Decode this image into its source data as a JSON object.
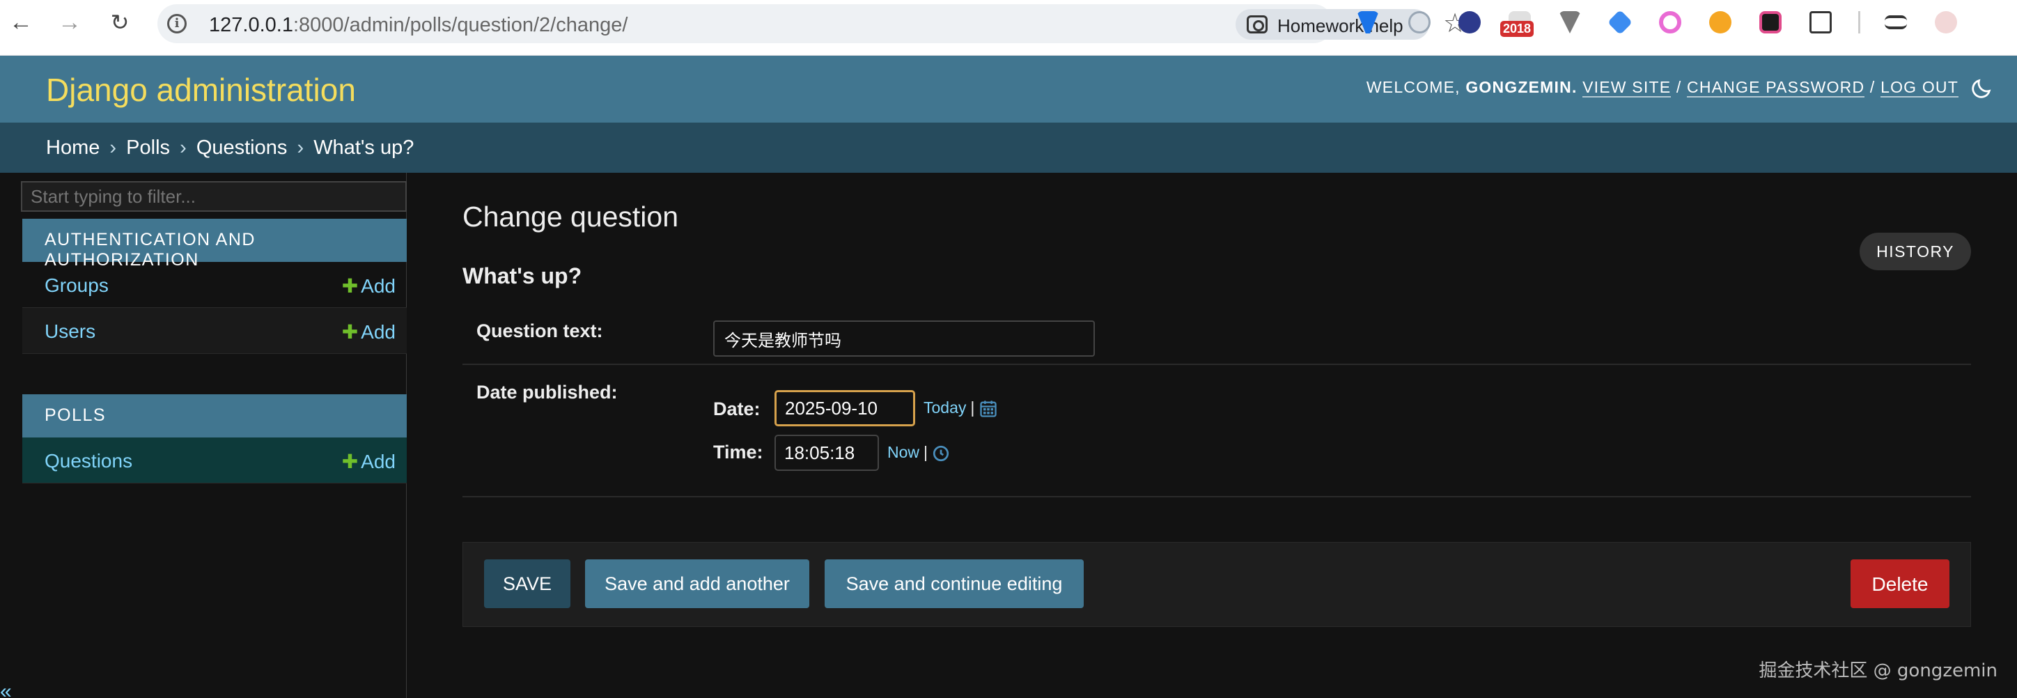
{
  "browser": {
    "url_host": "127.0.0.1",
    "url_path": ":8000/admin/polls/question/2/change/",
    "chip_label": "Homework help",
    "extension_badge": "2018"
  },
  "header": {
    "site_name": "Django administration",
    "welcome": "WELCOME,",
    "username": "GONGZEMIN.",
    "view_site": "VIEW SITE",
    "change_password": "CHANGE PASSWORD",
    "log_out": "LOG OUT",
    "separator": "/"
  },
  "breadcrumbs": {
    "items": [
      "Home",
      "Polls",
      "Questions",
      "What's up?"
    ],
    "separator": "›"
  },
  "sidebar": {
    "filter_placeholder": "Start typing to filter...",
    "apps": [
      {
        "caption": "AUTHENTICATION AND AUTHORIZATION",
        "models": [
          {
            "name": "Groups",
            "add_label": "Add"
          },
          {
            "name": "Users",
            "add_label": "Add"
          }
        ]
      },
      {
        "caption": "POLLS",
        "models": [
          {
            "name": "Questions",
            "add_label": "Add",
            "current": true
          }
        ]
      }
    ],
    "plus_symbol": "✚",
    "collapse_symbol": "«"
  },
  "content": {
    "page_title": "Change question",
    "history_label": "HISTORY",
    "object_title": "What's up?",
    "question_text": {
      "label": "Question text:",
      "value": "今天是教师节吗"
    },
    "date_published": {
      "label": "Date published:",
      "date_label": "Date:",
      "date_value": "2025-09-10",
      "today_label": "Today",
      "time_label": "Time:",
      "time_value": "18:05:18",
      "now_label": "Now",
      "pipe": "|"
    },
    "buttons": {
      "save": "SAVE",
      "save_add_another": "Save and add another",
      "save_continue": "Save and continue editing",
      "delete": "Delete"
    }
  },
  "watermark": "掘金技术社区 @ gongzemin",
  "colors": {
    "header_bg": "#417690",
    "breadcrumbs_bg": "#264b5d",
    "site_name": "#f5dd5d",
    "link": "#81d4fa",
    "add_plus": "#70bf2b",
    "delete": "#ba2121",
    "focus_border": "#d7a24c"
  }
}
